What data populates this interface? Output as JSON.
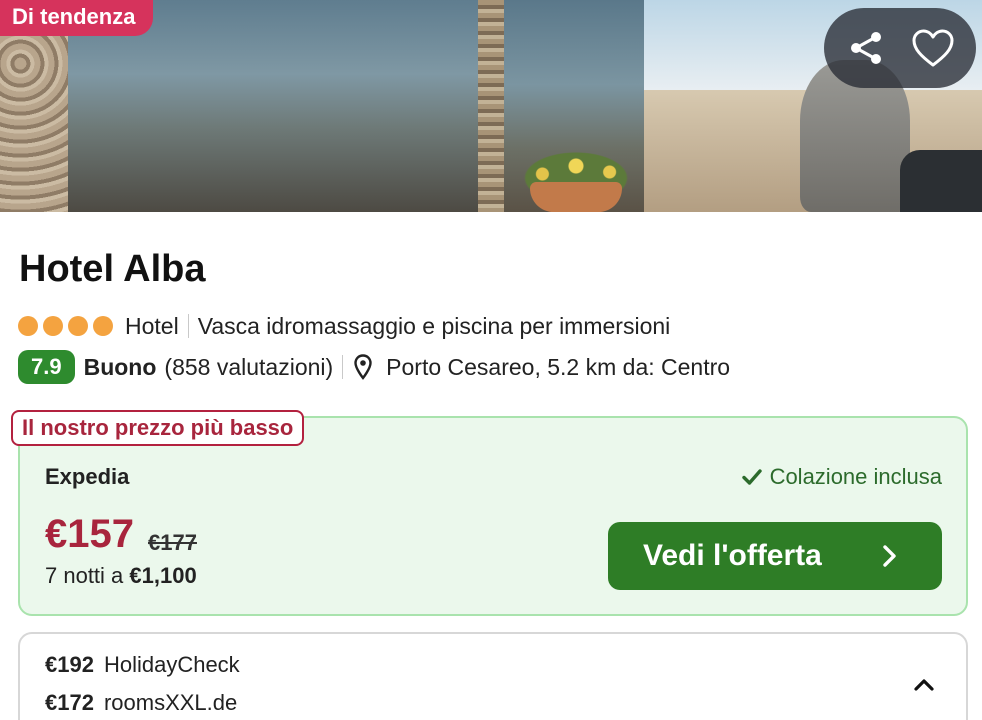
{
  "hero": {
    "badge": "Di tendenza",
    "actions": {
      "share_icon": "share-icon",
      "favorite_icon": "heart-icon"
    }
  },
  "hotel": {
    "name": "Hotel Alba",
    "stars": 4,
    "type": "Hotel",
    "feature": "Vasca idromassaggio e piscina per immersioni",
    "score": "7.9",
    "rating_word": "Buono",
    "reviews": "(858 valutazioni)",
    "location": "Porto Cesareo, 5.2 km da: Centro"
  },
  "best_offer": {
    "label": "Il nostro prezzo più basso",
    "provider": "Expedia",
    "perk": "Colazione inclusa",
    "price": "€157",
    "old_price": "€177",
    "nights_prefix": "7 notti a",
    "nights_total": "€1,100",
    "cta": "Vedi l'offerta"
  },
  "other_offers": [
    {
      "price": "€192",
      "provider": "HolidayCheck"
    },
    {
      "price": "€172",
      "provider": "roomsXXL.de"
    }
  ],
  "colors": {
    "accent_green": "#2e7d26",
    "badge_red": "#d6335c",
    "price_red": "#a8253d",
    "star_orange": "#f4a340"
  }
}
